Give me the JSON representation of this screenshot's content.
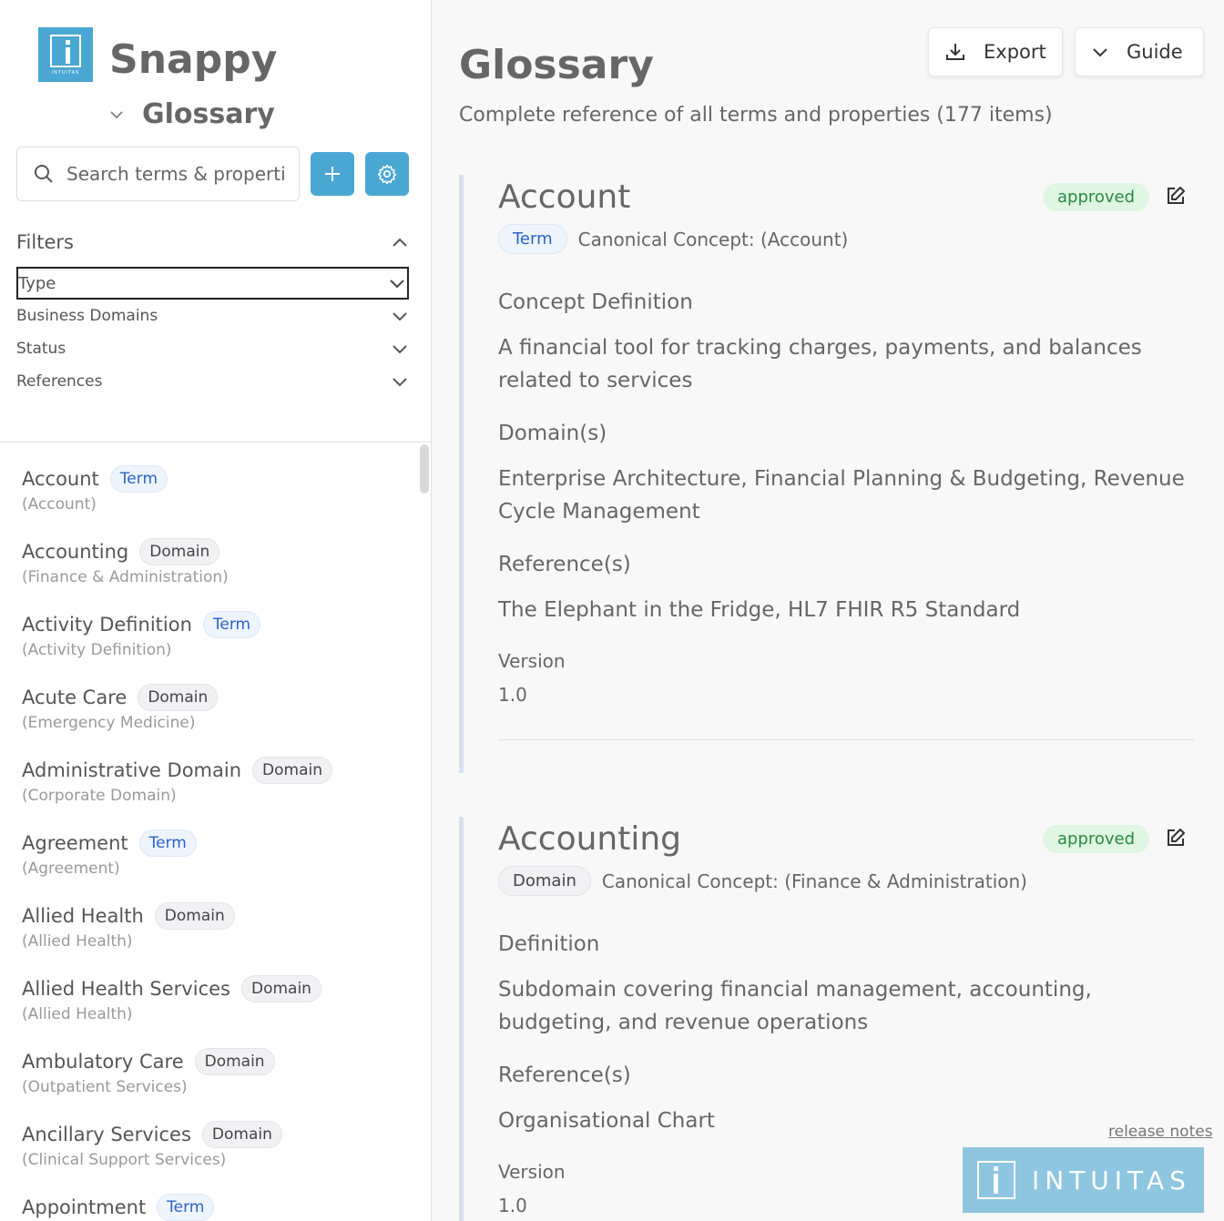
{
  "app": {
    "name": "Snappy",
    "logo_text": "INTUITAS",
    "section": "Glossary"
  },
  "search": {
    "placeholder": "Search terms & properties"
  },
  "toolbar": {
    "add_icon": "plus-icon",
    "settings_icon": "gear-icon"
  },
  "filters": {
    "title": "Filters",
    "type_label": "Type",
    "rows": [
      "Business Domains",
      "Status",
      "References"
    ]
  },
  "items": [
    {
      "name": "Account",
      "badge": "Term",
      "sub": "(Account)"
    },
    {
      "name": "Accounting",
      "badge": "Domain",
      "sub": "(Finance & Administration)"
    },
    {
      "name": "Activity Definition",
      "badge": "Term",
      "sub": "(Activity Definition)"
    },
    {
      "name": "Acute Care",
      "badge": "Domain",
      "sub": "(Emergency Medicine)"
    },
    {
      "name": "Administrative Domain",
      "badge": "Domain",
      "sub": "(Corporate Domain)"
    },
    {
      "name": "Agreement",
      "badge": "Term",
      "sub": "(Agreement)"
    },
    {
      "name": "Allied Health",
      "badge": "Domain",
      "sub": "(Allied Health)"
    },
    {
      "name": "Allied Health Services",
      "badge": "Domain",
      "sub": "(Allied Health)"
    },
    {
      "name": "Ambulatory Care",
      "badge": "Domain",
      "sub": "(Outpatient Services)"
    },
    {
      "name": "Ancillary Services",
      "badge": "Domain",
      "sub": "(Clinical Support Services)"
    },
    {
      "name": "Appointment",
      "badge": "Term",
      "sub": ""
    }
  ],
  "main": {
    "title": "Glossary",
    "subtitle": "Complete reference of all terms and properties (177 items)",
    "export_label": "Export",
    "guide_label": "Guide"
  },
  "cards": [
    {
      "title": "Account",
      "status": "approved",
      "badge": "Term",
      "canonical": "Canonical Concept: (Account)",
      "def_label": "Concept Definition",
      "def_value": "A financial tool for tracking charges, payments, and balances related to services",
      "domain_label": "Domain(s)",
      "domain_value": "Enterprise Architecture, Financial Planning & Budgeting, Revenue Cycle Management",
      "ref_label": "Reference(s)",
      "ref_value": "The Elephant in the Fridge, HL7 FHIR R5 Standard",
      "version_label": "Version",
      "version_value": "1.0"
    },
    {
      "title": "Accounting",
      "status": "approved",
      "badge": "Domain",
      "canonical": "Canonical Concept: (Finance & Administration)",
      "def_label": "Definition",
      "def_value": "Subdomain covering financial management, accounting, budgeting, and revenue operations",
      "ref_label": "Reference(s)",
      "ref_value": "Organisational Chart",
      "version_label": "Version",
      "version_value": "1.0"
    }
  ],
  "footer": {
    "release_notes": "release notes",
    "brand": "INTUITAS"
  },
  "colors": {
    "accent": "#4aa7d1",
    "approved_bg": "#def6e2",
    "approved_text": "#2a8a3f",
    "term_text": "#2b62c9"
  }
}
